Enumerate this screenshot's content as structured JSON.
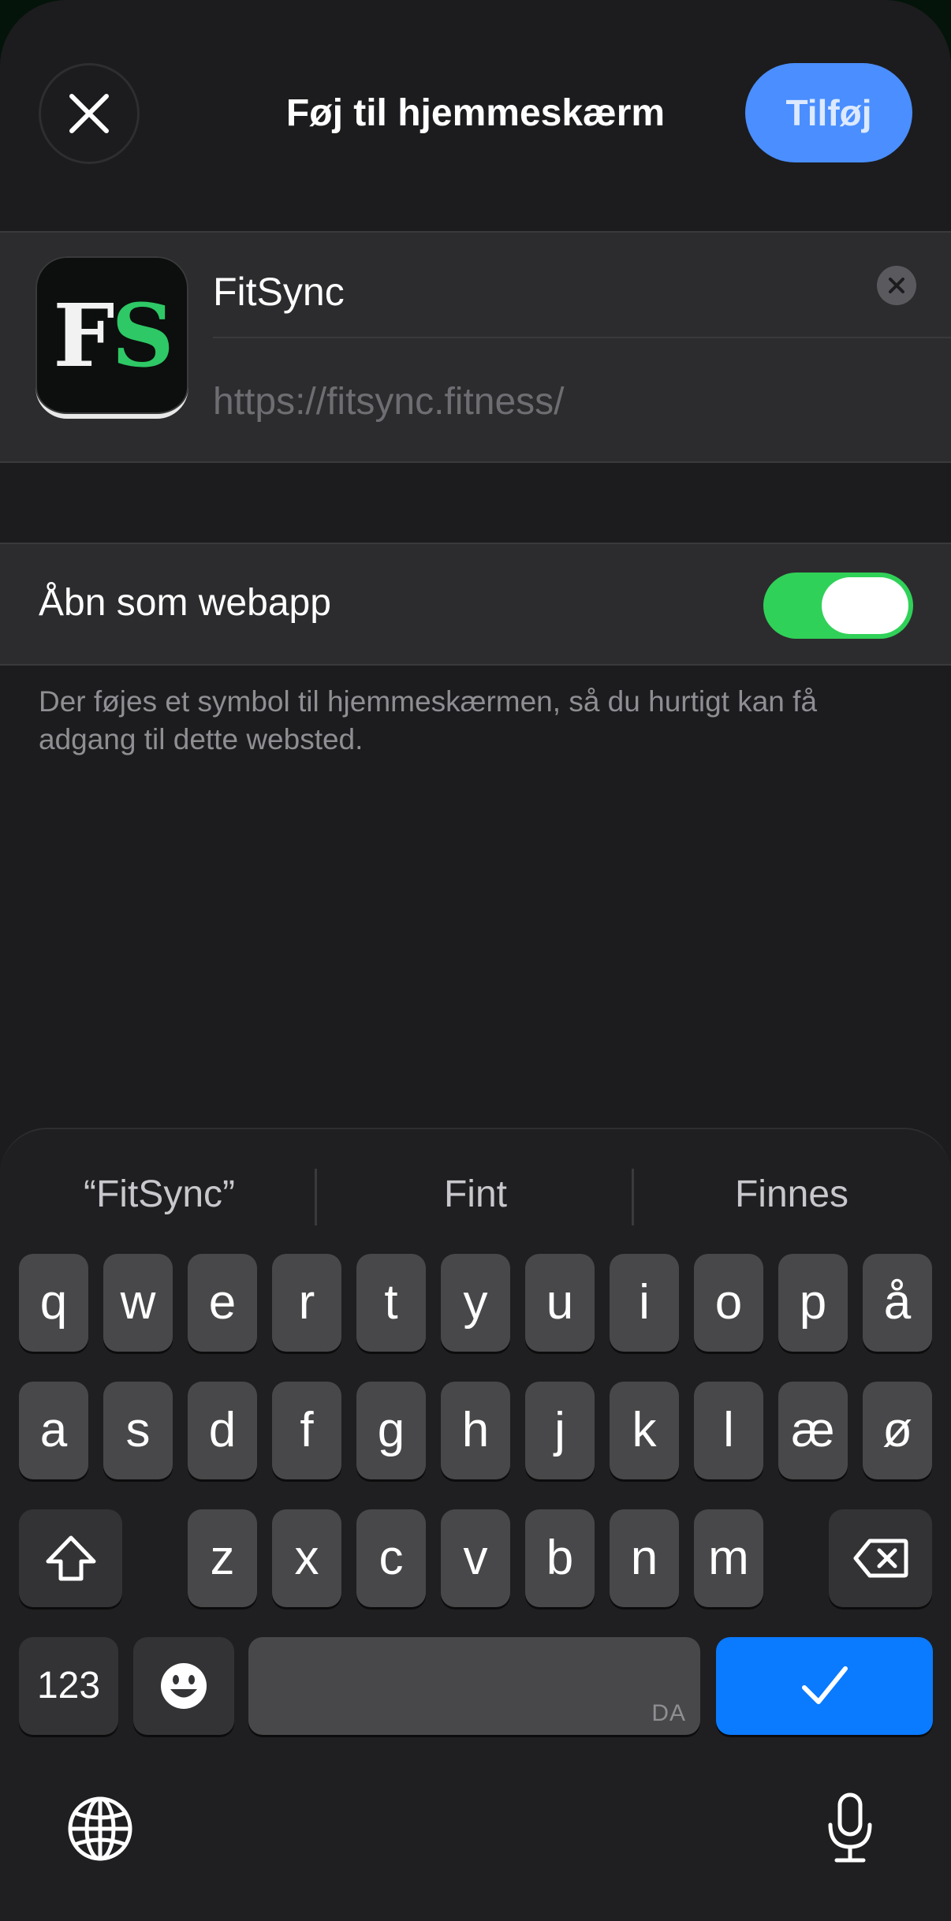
{
  "header": {
    "title": "Føj til hjemmeskærm",
    "add_label": "Tilføj",
    "close_icon": "close-icon"
  },
  "app": {
    "icon_letter_1": "F",
    "icon_letter_2": "S",
    "icon_letter_1_color": "#f2f2f2",
    "icon_letter_2_color": "#2ec866",
    "name_value": "FitSync",
    "url": "https://fitsync.fitness/"
  },
  "webapp": {
    "label": "Åbn som webapp",
    "enabled": true,
    "toggle_color": "#30d158"
  },
  "footnote": "Der føjes et symbol til hjemmeskærmen, så du hurtigt kan få adgang til dette websted.",
  "keyboard": {
    "suggestions": [
      "“FitSync”",
      "Fint",
      "Finnes"
    ],
    "row1": [
      "q",
      "w",
      "e",
      "r",
      "t",
      "y",
      "u",
      "i",
      "o",
      "p",
      "å"
    ],
    "row2": [
      "a",
      "s",
      "d",
      "f",
      "g",
      "h",
      "j",
      "k",
      "l",
      "æ",
      "ø"
    ],
    "row3": [
      "z",
      "x",
      "c",
      "v",
      "b",
      "n",
      "m"
    ],
    "numbers_label": "123",
    "space_language": "DA",
    "done_color": "#0a7aff",
    "icons": [
      "shift-icon",
      "backspace-icon",
      "emoji-icon",
      "checkmark-icon",
      "globe-icon",
      "microphone-icon"
    ]
  }
}
